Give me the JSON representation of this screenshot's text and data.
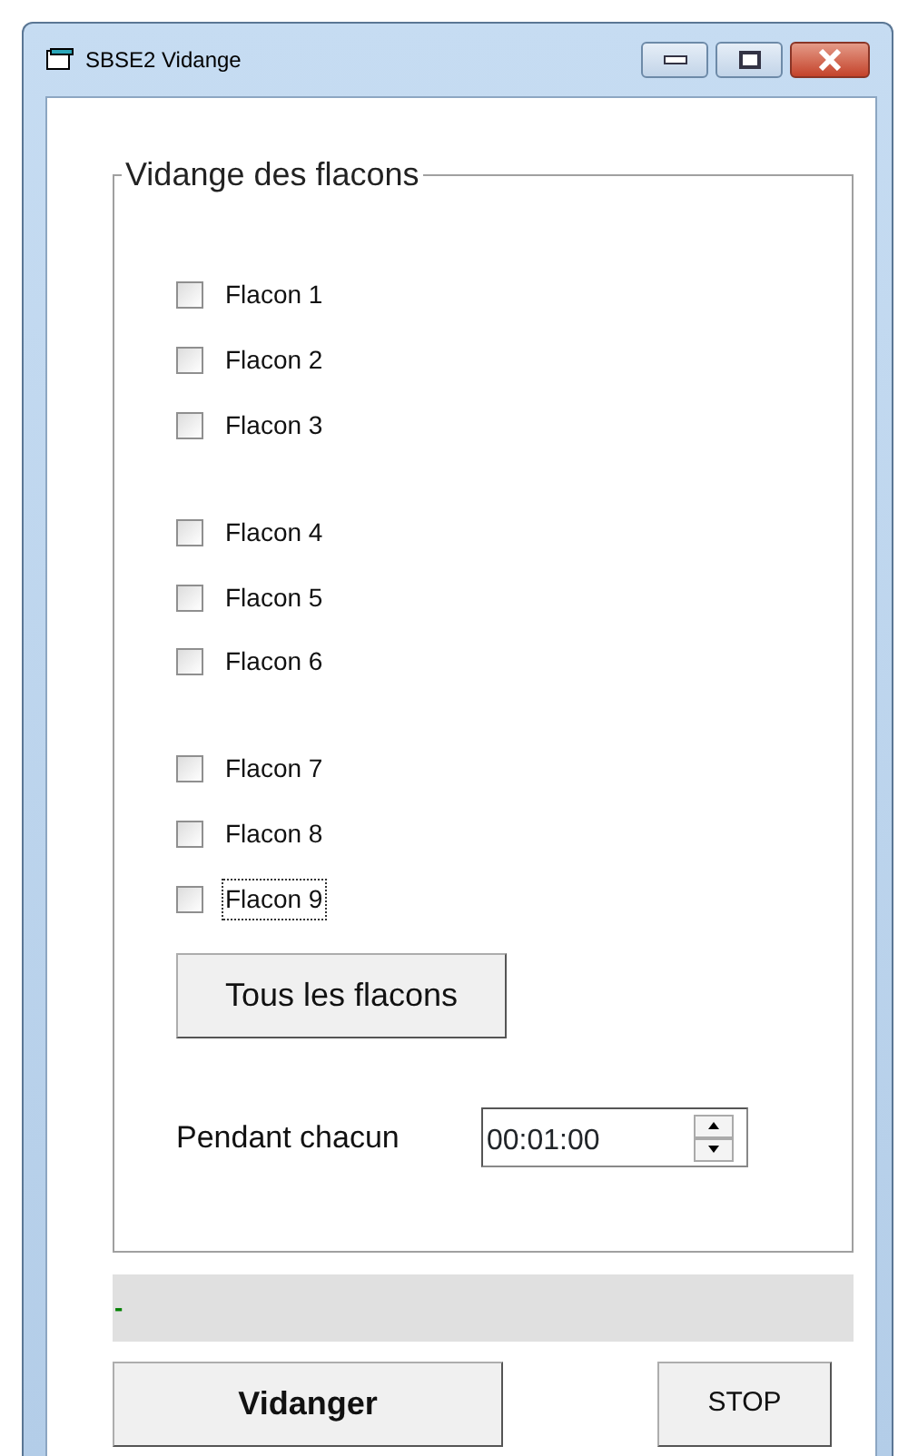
{
  "window": {
    "title": "SBSE2 Vidange"
  },
  "group": {
    "title": "Vidange des flacons",
    "checkbox_groups": [
      [
        {
          "label": "Flacon 1",
          "checked": false,
          "focused": false
        },
        {
          "label": "Flacon 2",
          "checked": false,
          "focused": false
        },
        {
          "label": "Flacon 3",
          "checked": false,
          "focused": false
        }
      ],
      [
        {
          "label": "Flacon 4",
          "checked": false,
          "focused": false
        },
        {
          "label": "Flacon 5",
          "checked": false,
          "focused": false
        },
        {
          "label": "Flacon 6",
          "checked": false,
          "focused": false
        }
      ],
      [
        {
          "label": "Flacon 7",
          "checked": false,
          "focused": false
        },
        {
          "label": "Flacon 8",
          "checked": false,
          "focused": false
        },
        {
          "label": "Flacon 9",
          "checked": false,
          "focused": true
        }
      ]
    ],
    "all_button": "Tous les flacons",
    "duration": {
      "label": "Pendant chacun",
      "value": "00:01:00"
    }
  },
  "status": {
    "text": "-",
    "color": "#008000"
  },
  "buttons": [
    {
      "label": "Vidanger",
      "kind": "primary"
    },
    {
      "label": "STOP",
      "kind": "secondary"
    }
  ]
}
